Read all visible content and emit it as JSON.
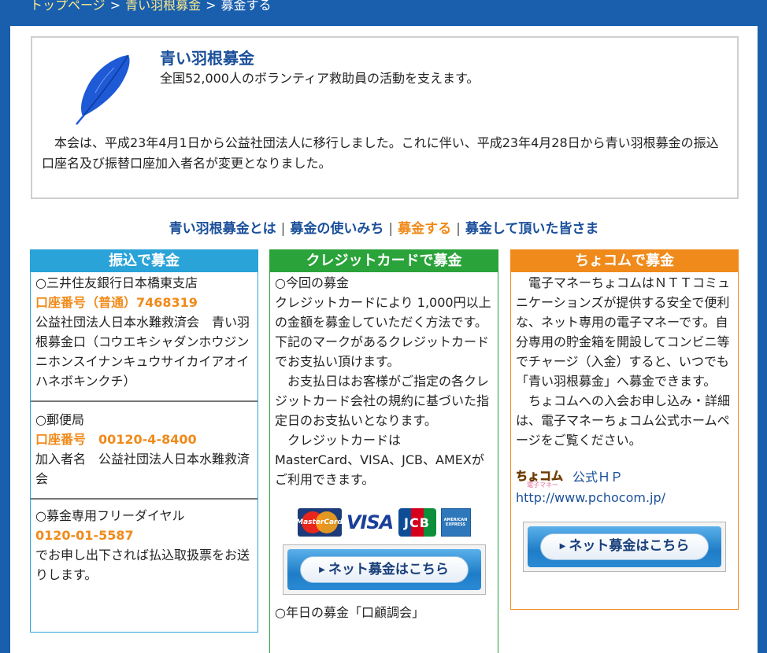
{
  "breadcrumb": {
    "home": "トップページ",
    "section": "青い羽根募金",
    "current": "募金する",
    "separator": ">"
  },
  "intro": {
    "title": "青い羽根募金",
    "subtitle": "全国52,000人のボランティア救助員の活動を支えます。",
    "notice": "本会は、平成23年4月1日から公益社団法人に移行しました。これに伴い、平成23年4月28日から青い羽根募金の振込口座名及び振替口座加入者名が変更となりました。",
    "feather_color": "#1e5ad6"
  },
  "nav": {
    "items": [
      {
        "label": "青い羽根募金とは",
        "active": false
      },
      {
        "label": "募金の使いみち",
        "active": false
      },
      {
        "label": "募金する",
        "active": true
      },
      {
        "label": "募金して頂いた皆さま",
        "active": false
      }
    ],
    "separator": "|"
  },
  "bank": {
    "title": "振込で募金",
    "color": "#2aa3d8",
    "sections": [
      {
        "heading": "○三井住友銀行日本橋東支店",
        "highlight": "口座番号（普通）7468319",
        "text": "公益社団法人日本水難救済会　青い羽根募金口（コウエキシャダンホウジンニホンスイナンキュウサイカイアオイハネボキンクチ）"
      },
      {
        "heading": "○郵便局",
        "highlight": "口座番号　00120-4-8400",
        "text": "加入者名　公益社団法人日本水難救済会"
      },
      {
        "heading": "○募金専用フリーダイヤル",
        "highlight": "0120-01-5587",
        "text": "でお申し出下されば払込取扱票をお送りします。"
      }
    ]
  },
  "credit": {
    "title": "クレジットカードで募金",
    "color": "#2aa33a",
    "heading": "○今回の募金",
    "p1": "クレジットカードにより 1,000円以上の金額を募金していただく方法です。",
    "p2": "下記のマークがあるクレジットカードでお支払い頂けます。",
    "p3": "お支払日はお客様がご指定の各クレジットカード会社の規約に基づいた指定日のお支払いとなります。",
    "p4": "クレジットカードは",
    "p5": "MasterCard、VISA、JCB、AMEXがご利用できます。",
    "cards": {
      "mastercard": "MasterCard",
      "visa": "VISA",
      "jcb": "JCB",
      "amex": "AMERICAN EXPRESS"
    },
    "button": "ネット募金はこちら",
    "cutoff": "○年日の募金「口顧調会」"
  },
  "chocom": {
    "title": "ちょコムで募金",
    "color": "#f08a1a",
    "p1": "電子マネーちょコムはＮＴＴコミュニケーションズが提供する安全で便利な、ネット専用の電子マネーです。自分専用の貯金箱を開設してコンビニ等でチャージ（入金）すると、いつでも「青い羽根募金」へ募金できます。",
    "p2": "ちょコムへの入会お申し込み・詳細は、電子マネーちょコム公式ホームページをご覧ください。",
    "logo_top": "ちょコム",
    "logo_sub": "電子マネー",
    "hp_label": "公式ＨＰ",
    "url": "http://www.pchocom.jp/",
    "button": "ネット募金はこちら"
  }
}
